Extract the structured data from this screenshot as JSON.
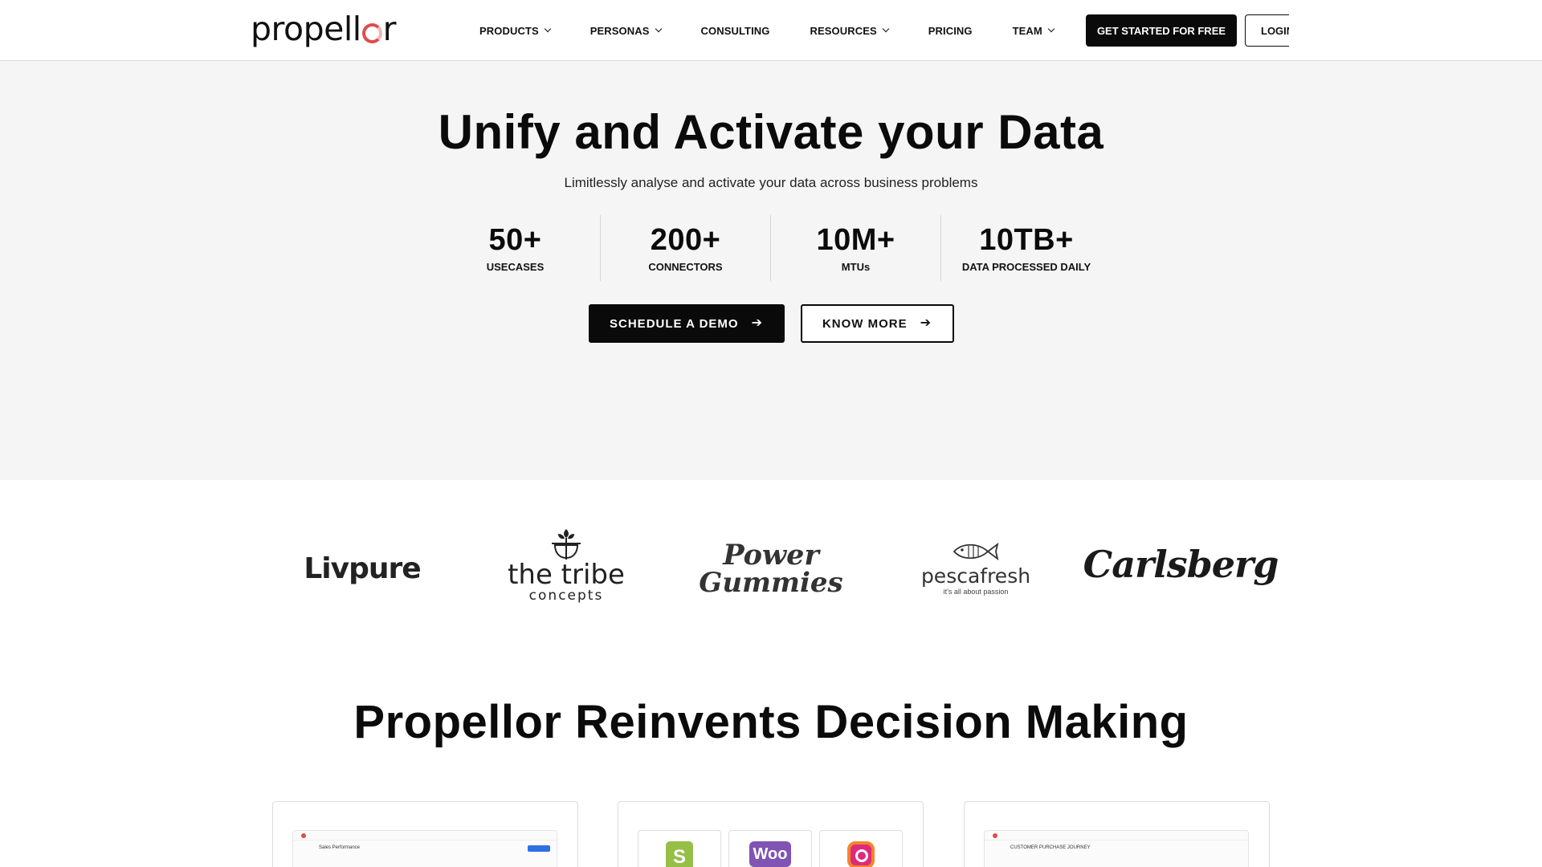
{
  "brand": {
    "name_part1": "propell",
    "name_part2": "r"
  },
  "nav": {
    "items": [
      {
        "label": "PRODUCTS",
        "dropdown": true
      },
      {
        "label": "PERSONAS",
        "dropdown": true
      },
      {
        "label": "CONSULTING",
        "dropdown": false
      },
      {
        "label": "RESOURCES",
        "dropdown": true
      },
      {
        "label": "PRICING",
        "dropdown": false
      },
      {
        "label": "TEAM",
        "dropdown": true
      }
    ],
    "cta_label": "GET STARTED FOR FREE",
    "login_label": "LOGIN"
  },
  "hero": {
    "title": "Unify and Activate your Data",
    "subtitle": "Limitlessly analyse and activate your data across business problems",
    "stats": [
      {
        "value": "50+",
        "label": "USECASES"
      },
      {
        "value": "200+",
        "label": "CONNECTORS"
      },
      {
        "value": "10M+",
        "label": "MTUs"
      },
      {
        "value": "10TB+",
        "label": "DATA PROCESSED DAILY"
      }
    ],
    "demo_label": "SCHEDULE A DEMO",
    "know_label": "KNOW MORE"
  },
  "clients": {
    "livpure": "Livpure",
    "tribe_line1": "the tribe",
    "tribe_line2": "concepts",
    "power_line1": "Power",
    "power_line2": "Gummies",
    "pescafresh": "pescafresh",
    "pescafresh_tagline": "it's all about passion",
    "carlsberg": "Carlsberg"
  },
  "section2": {
    "title": "Propellor Reinvents Decision Making",
    "card1_heading": "Sales Performance",
    "card3_heading": "CUSTOMER PURCHASE JOURNEY",
    "card2_tiles": [
      "S",
      "Woo"
    ]
  },
  "colors": {
    "accent": "#e04b4b",
    "dark": "#0a0a0a",
    "hero_bg": "#f5f5f5"
  },
  "icons": [
    "chevron-down-icon",
    "arrow-right-icon",
    "shopify-icon",
    "woocommerce-icon",
    "instagram-icon"
  ]
}
